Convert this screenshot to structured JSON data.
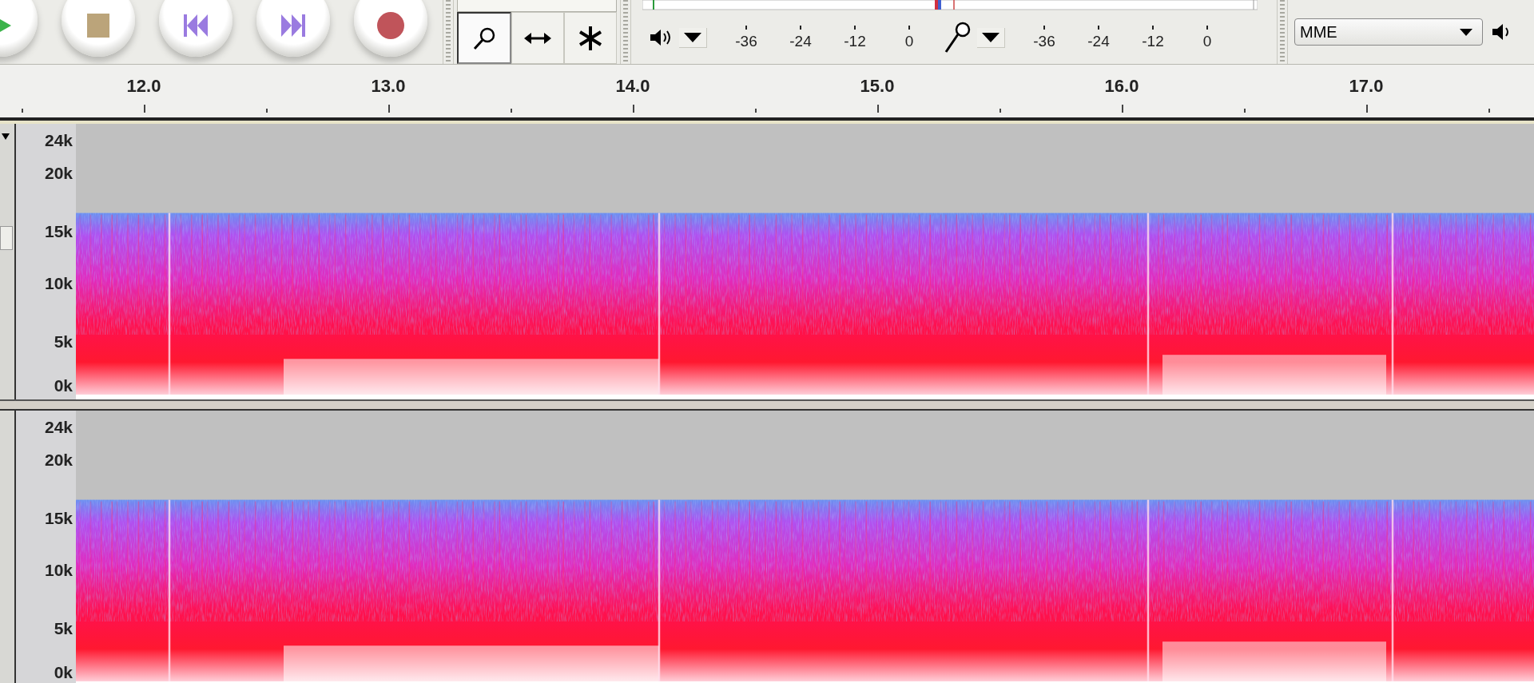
{
  "transport": {
    "buttons": [
      {
        "kind": "play"
      },
      {
        "kind": "stop"
      },
      {
        "kind": "skip-start"
      },
      {
        "kind": "skip-end"
      },
      {
        "kind": "record"
      }
    ]
  },
  "tools": [
    {
      "kind": "zoom",
      "selected": true
    },
    {
      "kind": "time-shift",
      "selected": false
    },
    {
      "kind": "multi",
      "selected": false
    }
  ],
  "meters": [
    {
      "kind": "playback",
      "scale": [
        "-36",
        "-24",
        "-12",
        "0"
      ]
    },
    {
      "kind": "recording",
      "scale": [
        "-36",
        "-24",
        "-12",
        "0"
      ]
    }
  ],
  "device": {
    "host": "MME"
  },
  "ruler": {
    "labels": [
      "12.0",
      "13.0",
      "14.0",
      "15.0",
      "16.0",
      "17.0"
    ]
  },
  "tracks": [
    {
      "freq_labels": [
        "24k",
        "20k",
        "15k",
        "10k",
        "5k",
        "0k"
      ]
    },
    {
      "freq_labels": [
        "24k",
        "20k",
        "15k",
        "10k",
        "5k",
        "0k"
      ]
    }
  ]
}
